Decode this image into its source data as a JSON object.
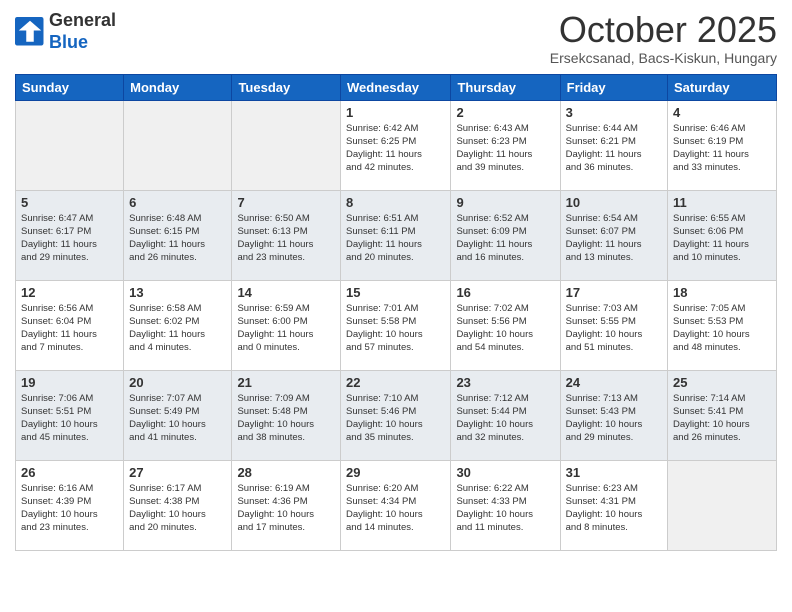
{
  "logo": {
    "general": "General",
    "blue": "Blue"
  },
  "title": "October 2025",
  "location": "Ersekcsanad, Bacs-Kiskun, Hungary",
  "days_of_week": [
    "Sunday",
    "Monday",
    "Tuesday",
    "Wednesday",
    "Thursday",
    "Friday",
    "Saturday"
  ],
  "weeks": [
    [
      {
        "num": "",
        "info": ""
      },
      {
        "num": "",
        "info": ""
      },
      {
        "num": "",
        "info": ""
      },
      {
        "num": "1",
        "info": "Sunrise: 6:42 AM\nSunset: 6:25 PM\nDaylight: 11 hours\nand 42 minutes."
      },
      {
        "num": "2",
        "info": "Sunrise: 6:43 AM\nSunset: 6:23 PM\nDaylight: 11 hours\nand 39 minutes."
      },
      {
        "num": "3",
        "info": "Sunrise: 6:44 AM\nSunset: 6:21 PM\nDaylight: 11 hours\nand 36 minutes."
      },
      {
        "num": "4",
        "info": "Sunrise: 6:46 AM\nSunset: 6:19 PM\nDaylight: 11 hours\nand 33 minutes."
      }
    ],
    [
      {
        "num": "5",
        "info": "Sunrise: 6:47 AM\nSunset: 6:17 PM\nDaylight: 11 hours\nand 29 minutes."
      },
      {
        "num": "6",
        "info": "Sunrise: 6:48 AM\nSunset: 6:15 PM\nDaylight: 11 hours\nand 26 minutes."
      },
      {
        "num": "7",
        "info": "Sunrise: 6:50 AM\nSunset: 6:13 PM\nDaylight: 11 hours\nand 23 minutes."
      },
      {
        "num": "8",
        "info": "Sunrise: 6:51 AM\nSunset: 6:11 PM\nDaylight: 11 hours\nand 20 minutes."
      },
      {
        "num": "9",
        "info": "Sunrise: 6:52 AM\nSunset: 6:09 PM\nDaylight: 11 hours\nand 16 minutes."
      },
      {
        "num": "10",
        "info": "Sunrise: 6:54 AM\nSunset: 6:07 PM\nDaylight: 11 hours\nand 13 minutes."
      },
      {
        "num": "11",
        "info": "Sunrise: 6:55 AM\nSunset: 6:06 PM\nDaylight: 11 hours\nand 10 minutes."
      }
    ],
    [
      {
        "num": "12",
        "info": "Sunrise: 6:56 AM\nSunset: 6:04 PM\nDaylight: 11 hours\nand 7 minutes."
      },
      {
        "num": "13",
        "info": "Sunrise: 6:58 AM\nSunset: 6:02 PM\nDaylight: 11 hours\nand 4 minutes."
      },
      {
        "num": "14",
        "info": "Sunrise: 6:59 AM\nSunset: 6:00 PM\nDaylight: 11 hours\nand 0 minutes."
      },
      {
        "num": "15",
        "info": "Sunrise: 7:01 AM\nSunset: 5:58 PM\nDaylight: 10 hours\nand 57 minutes."
      },
      {
        "num": "16",
        "info": "Sunrise: 7:02 AM\nSunset: 5:56 PM\nDaylight: 10 hours\nand 54 minutes."
      },
      {
        "num": "17",
        "info": "Sunrise: 7:03 AM\nSunset: 5:55 PM\nDaylight: 10 hours\nand 51 minutes."
      },
      {
        "num": "18",
        "info": "Sunrise: 7:05 AM\nSunset: 5:53 PM\nDaylight: 10 hours\nand 48 minutes."
      }
    ],
    [
      {
        "num": "19",
        "info": "Sunrise: 7:06 AM\nSunset: 5:51 PM\nDaylight: 10 hours\nand 45 minutes."
      },
      {
        "num": "20",
        "info": "Sunrise: 7:07 AM\nSunset: 5:49 PM\nDaylight: 10 hours\nand 41 minutes."
      },
      {
        "num": "21",
        "info": "Sunrise: 7:09 AM\nSunset: 5:48 PM\nDaylight: 10 hours\nand 38 minutes."
      },
      {
        "num": "22",
        "info": "Sunrise: 7:10 AM\nSunset: 5:46 PM\nDaylight: 10 hours\nand 35 minutes."
      },
      {
        "num": "23",
        "info": "Sunrise: 7:12 AM\nSunset: 5:44 PM\nDaylight: 10 hours\nand 32 minutes."
      },
      {
        "num": "24",
        "info": "Sunrise: 7:13 AM\nSunset: 5:43 PM\nDaylight: 10 hours\nand 29 minutes."
      },
      {
        "num": "25",
        "info": "Sunrise: 7:14 AM\nSunset: 5:41 PM\nDaylight: 10 hours\nand 26 minutes."
      }
    ],
    [
      {
        "num": "26",
        "info": "Sunrise: 6:16 AM\nSunset: 4:39 PM\nDaylight: 10 hours\nand 23 minutes."
      },
      {
        "num": "27",
        "info": "Sunrise: 6:17 AM\nSunset: 4:38 PM\nDaylight: 10 hours\nand 20 minutes."
      },
      {
        "num": "28",
        "info": "Sunrise: 6:19 AM\nSunset: 4:36 PM\nDaylight: 10 hours\nand 17 minutes."
      },
      {
        "num": "29",
        "info": "Sunrise: 6:20 AM\nSunset: 4:34 PM\nDaylight: 10 hours\nand 14 minutes."
      },
      {
        "num": "30",
        "info": "Sunrise: 6:22 AM\nSunset: 4:33 PM\nDaylight: 10 hours\nand 11 minutes."
      },
      {
        "num": "31",
        "info": "Sunrise: 6:23 AM\nSunset: 4:31 PM\nDaylight: 10 hours\nand 8 minutes."
      },
      {
        "num": "",
        "info": ""
      }
    ]
  ]
}
